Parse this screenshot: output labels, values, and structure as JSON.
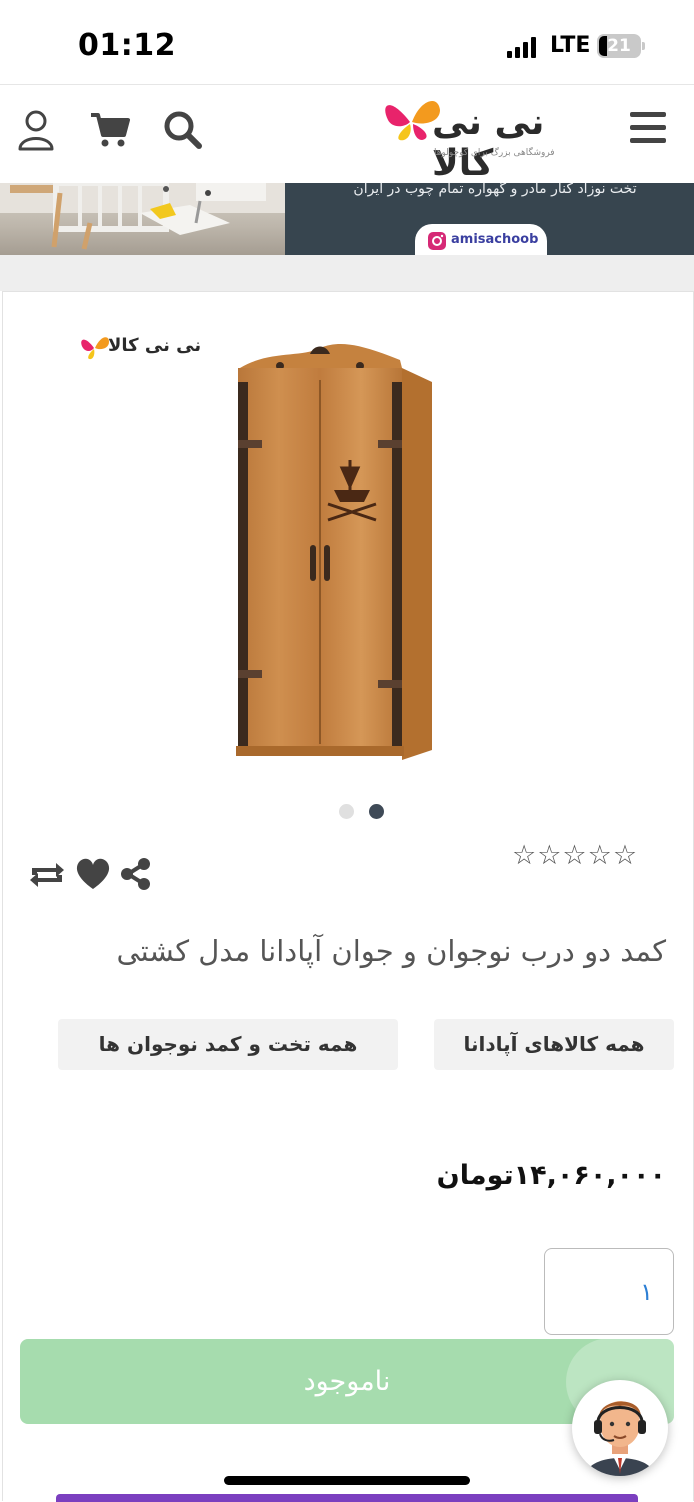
{
  "status_bar": {
    "time": "01:12",
    "network": "LTE",
    "battery": "21"
  },
  "header": {
    "logo_text": "نی نی کالا",
    "logo_tagline": "فروشگاهی بزرگ برای کوچولوها",
    "icons": [
      "menu-icon",
      "search-icon",
      "cart-icon",
      "user-icon"
    ]
  },
  "banner": {
    "caption": "تخت نوزاد کنار مادر و گهواره تمام چوب در ایران",
    "instagram_handle": "amisachoob"
  },
  "product": {
    "image_logo_text": "نی نی کالا",
    "carousel": {
      "count": 2,
      "active_index": 1
    },
    "rating": {
      "stars_filled": 0,
      "stars_total": 5,
      "display": "☆☆☆☆☆"
    },
    "title": "کمد دو درب نوجوان و جوان آپادانا مدل کشتی",
    "tags": [
      "همه کالاهای آپادانا",
      "همه تخت و کمد نوجوان ها"
    ],
    "price": "۱۴,۰۶۰,۰۰۰تومان",
    "quantity": "۱",
    "availability_button": "ناموجود"
  },
  "colors": {
    "unavailable_button": "#a6dcae",
    "banner_dark": "#37454f",
    "quantity_text": "#2d7fd4",
    "bottom_bar": "#7b3fbf"
  }
}
